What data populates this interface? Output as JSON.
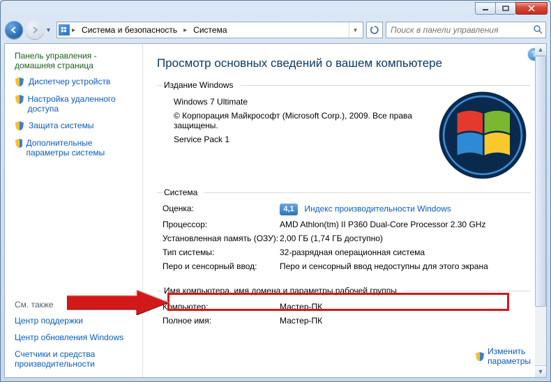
{
  "address": {
    "crumb1": "Система и безопасность",
    "crumb2": "Система"
  },
  "search": {
    "placeholder": "Поиск в панели управления"
  },
  "sidebar": {
    "home1": "Панель управления -",
    "home2": "домашняя страница",
    "links": [
      "Диспетчер устройств",
      "Настройка удаленного доступа",
      "Защита системы",
      "Дополнительные параметры системы"
    ],
    "see_also": "См. также",
    "see_links": [
      "Центр поддержки",
      "Центр обновления Windows",
      "Счетчики и средства производительности"
    ]
  },
  "main": {
    "heading": "Просмотр основных сведений о вашем компьютере",
    "group_edition": "Издание Windows",
    "edition_name": "Windows 7 Ultimate",
    "copyright": "© Корпорация Майкрософт (Microsoft Corp.), 2009. Все права защищены.",
    "service_pack": "Service Pack 1",
    "group_system": "Система",
    "rating_label": "Оценка:",
    "rating_value": "4,1",
    "rating_link": "Индекс производительности Windows",
    "cpu_label": "Процессор:",
    "cpu_value": "AMD Athlon(tm) II P360 Dual-Core Processor   2.30 GHz",
    "ram_label": "Установленная память (ОЗУ):",
    "ram_value": "2,00 ГБ (1,74 ГБ доступно)",
    "type_label": "Тип системы:",
    "type_value": "32-разрядная операционная система",
    "pen_label": "Перо и сенсорный ввод:",
    "pen_value": "Перо и сенсорный ввод недоступны для этого экрана",
    "group_domain": "Имя компьютера, имя домена и параметры рабочей группы",
    "comp_label": "Компьютер:",
    "comp_value": "Мастер-ПК",
    "full_label": "Полное имя:",
    "full_value": "Мастер-ПК",
    "change_link1": "Изменить",
    "change_link2": "параметры"
  }
}
